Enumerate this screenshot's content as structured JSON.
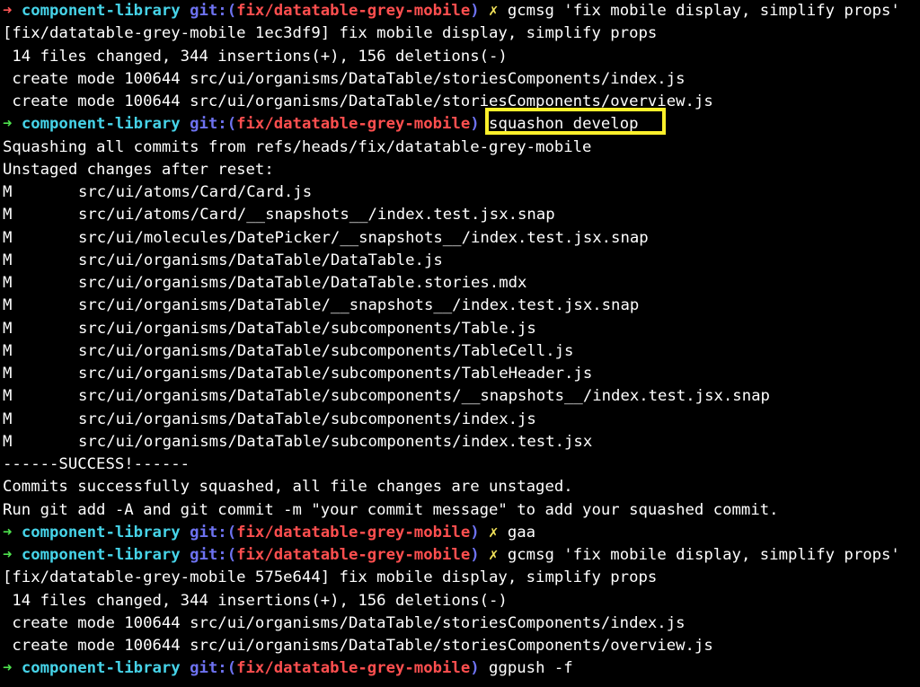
{
  "prompt": {
    "directory": "component-library",
    "git_label": "git:(",
    "branch": "fix/datatable-grey-mobile",
    "close_paren": ")",
    "dirty_mark": "✗",
    "arrow": "➜"
  },
  "lines": [
    {
      "type": "prompt",
      "status": "fail",
      "dirty": true,
      "command": "gcmsg 'fix mobile display, simplify props'"
    },
    {
      "type": "output",
      "text": "[fix/datatable-grey-mobile 1ec3df9] fix mobile display, simplify props"
    },
    {
      "type": "output",
      "text": " 14 files changed, 344 insertions(+), 156 deletions(-)"
    },
    {
      "type": "output",
      "text": " create mode 100644 src/ui/organisms/DataTable/storiesComponents/index.js"
    },
    {
      "type": "output",
      "text": " create mode 100644 src/ui/organisms/DataTable/storiesComponents/overview.js"
    },
    {
      "type": "prompt",
      "status": "ok",
      "dirty": false,
      "command": "squashon develop"
    },
    {
      "type": "output",
      "text": "Squashing all commits from refs/heads/fix/datatable-grey-mobile"
    },
    {
      "type": "output",
      "text": "Unstaged changes after reset:"
    },
    {
      "type": "file",
      "status": "M",
      "path": "src/ui/atoms/Card/Card.js"
    },
    {
      "type": "file",
      "status": "M",
      "path": "src/ui/atoms/Card/__snapshots__/index.test.jsx.snap"
    },
    {
      "type": "file",
      "status": "M",
      "path": "src/ui/molecules/DatePicker/__snapshots__/index.test.jsx.snap"
    },
    {
      "type": "file",
      "status": "M",
      "path": "src/ui/organisms/DataTable/DataTable.js"
    },
    {
      "type": "file",
      "status": "M",
      "path": "src/ui/organisms/DataTable/DataTable.stories.mdx"
    },
    {
      "type": "file",
      "status": "M",
      "path": "src/ui/organisms/DataTable/__snapshots__/index.test.jsx.snap"
    },
    {
      "type": "file",
      "status": "M",
      "path": "src/ui/organisms/DataTable/subcomponents/Table.js"
    },
    {
      "type": "file",
      "status": "M",
      "path": "src/ui/organisms/DataTable/subcomponents/TableCell.js"
    },
    {
      "type": "file",
      "status": "M",
      "path": "src/ui/organisms/DataTable/subcomponents/TableHeader.js"
    },
    {
      "type": "file",
      "status": "M",
      "path": "src/ui/organisms/DataTable/subcomponents/__snapshots__/index.test.jsx.snap"
    },
    {
      "type": "file",
      "status": "M",
      "path": "src/ui/organisms/DataTable/subcomponents/index.js"
    },
    {
      "type": "file",
      "status": "M",
      "path": "src/ui/organisms/DataTable/subcomponents/index.test.jsx"
    },
    {
      "type": "output",
      "text": "------SUCCESS!------"
    },
    {
      "type": "output",
      "text": "Commits successfully squashed, all file changes are unstaged."
    },
    {
      "type": "output",
      "text": "Run git add -A and git commit -m \"your commit message\" to add your squashed commit."
    },
    {
      "type": "prompt",
      "status": "ok",
      "dirty": true,
      "command": "gaa"
    },
    {
      "type": "prompt",
      "status": "ok",
      "dirty": true,
      "command": "gcmsg 'fix mobile display, simplify props'"
    },
    {
      "type": "output",
      "text": "[fix/datatable-grey-mobile 575e644] fix mobile display, simplify props"
    },
    {
      "type": "output",
      "text": " 14 files changed, 344 insertions(+), 156 deletions(-)"
    },
    {
      "type": "output",
      "text": " create mode 100644 src/ui/organisms/DataTable/storiesComponents/index.js"
    },
    {
      "type": "output",
      "text": " create mode 100644 src/ui/organisms/DataTable/storiesComponents/overview.js"
    },
    {
      "type": "prompt",
      "status": "ok",
      "dirty": false,
      "command": "ggpush -f"
    }
  ],
  "colors": {
    "background": "#000000",
    "text": "#ffffff",
    "arrow_fail": "#ff5555",
    "arrow_ok": "#4ee24e",
    "directory": "#46d3e8",
    "git": "#6d72f0",
    "branch": "#ff4f4f",
    "dirty": "#f4e45a",
    "highlight": "#fdf02b"
  }
}
